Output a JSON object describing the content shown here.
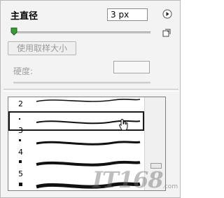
{
  "brush_options": {
    "diameter_label": "主直径",
    "diameter_value": "3 px",
    "diameter_slider": 0.0,
    "use_sample_size_label": "使用取样大小",
    "hardness_label": "硬度:"
  },
  "presets": [
    {
      "number": "2"
    },
    {
      "number": "3"
    },
    {
      "number": "4"
    },
    {
      "number": "5"
    }
  ],
  "watermark": {
    "text": "IT168",
    "suffix": ".com"
  },
  "colors": {
    "panel_bg": "#f3f3f3",
    "list_bg": "#ffffff",
    "selected_outline": "#1a1a1a",
    "slider_thumb": "#2e8f2e"
  }
}
